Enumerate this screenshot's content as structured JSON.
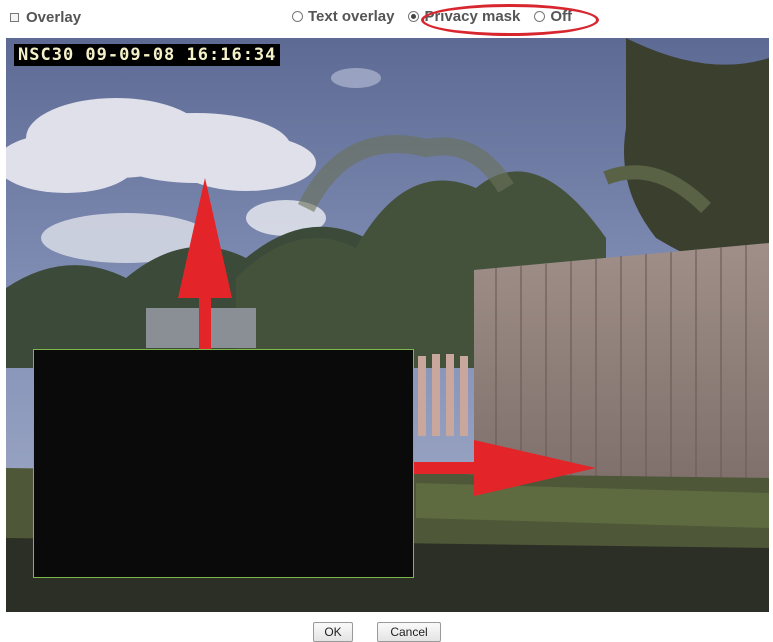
{
  "header": {
    "overlay_label": "Overlay",
    "options": [
      {
        "label": "Text overlay",
        "checked": false
      },
      {
        "label": "Privacy mask",
        "checked": true
      },
      {
        "label": "Off",
        "checked": false
      }
    ]
  },
  "camera": {
    "timestamp": "NSC30 09-09-08 16:16:34"
  },
  "buttons": {
    "ok": "OK",
    "cancel": "Cancel"
  },
  "colors": {
    "annotation_red": "#d8262f",
    "mask_border": "#7fb84a",
    "mask_fill": "#0a0a0a"
  }
}
